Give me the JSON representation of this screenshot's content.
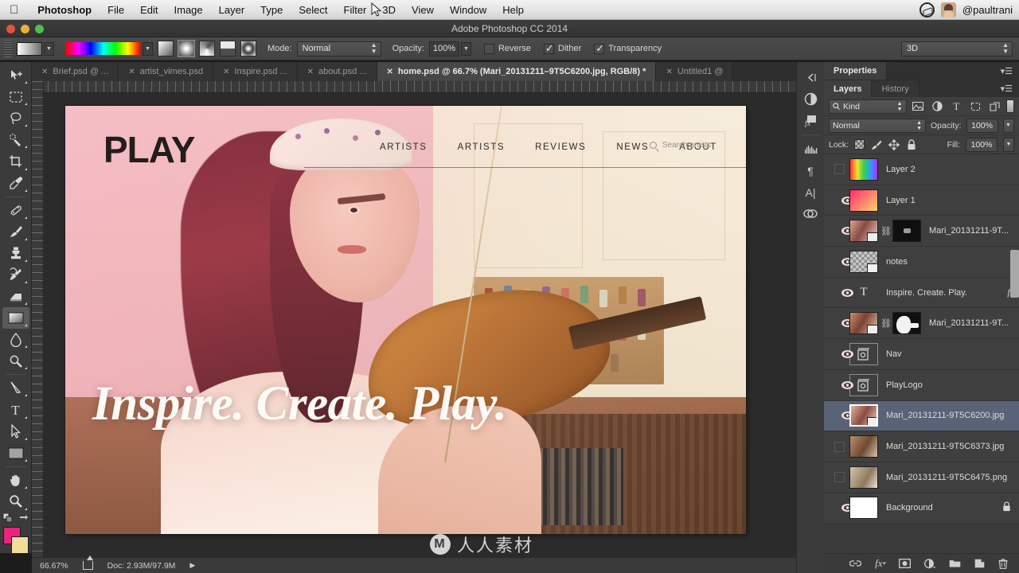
{
  "macmenu": {
    "apple_icon": "apple-logo",
    "items": [
      {
        "label": "Photoshop",
        "bold": true
      },
      {
        "label": "File",
        "bold": false
      },
      {
        "label": "Edit",
        "bold": false
      },
      {
        "label": "Image",
        "bold": false
      },
      {
        "label": "Layer",
        "bold": false
      },
      {
        "label": "Type",
        "bold": false
      },
      {
        "label": "Select",
        "bold": false
      },
      {
        "label": "Filter",
        "bold": false
      },
      {
        "label": "3D",
        "bold": false
      },
      {
        "label": "View",
        "bold": false
      },
      {
        "label": "Window",
        "bold": false
      },
      {
        "label": "Help",
        "bold": false
      }
    ],
    "user_handle": "@paultrani"
  },
  "window": {
    "title": "Adobe Photoshop CC 2014"
  },
  "options_bar": {
    "gradient_preset_label": "gradient-preset",
    "gradient_types": [
      "linear",
      "radial",
      "angle",
      "reflected",
      "diamond"
    ],
    "gradient_type_selected_index": 1,
    "mode_label": "Mode:",
    "mode_value": "Normal",
    "opacity_label": "Opacity:",
    "opacity_value": "100%",
    "reverse_label": "Reverse",
    "reverse_checked": false,
    "dither_label": "Dither",
    "dither_checked": true,
    "transparency_label": "Transparency",
    "transparency_checked": true,
    "workspace_value": "3D"
  },
  "tabs": [
    {
      "label": "Brief.psd @ ...",
      "active": false
    },
    {
      "label": "artist_vimes.psd",
      "active": false
    },
    {
      "label": "Inspire.psd ...",
      "active": false
    },
    {
      "label": "about.psd ...",
      "active": false
    },
    {
      "label": "home.psd @ 66.7% (Mari_20131211–9T5C6200.jpg, RGB/8) *",
      "active": true
    },
    {
      "label": "Untitled1 @",
      "active": false
    }
  ],
  "tabs_overflow": "»",
  "toolbar": {
    "tools": [
      {
        "name": "move-tool",
        "selected": false
      },
      {
        "name": "rectangular-marquee-tool",
        "selected": false
      },
      {
        "name": "lasso-tool",
        "selected": false
      },
      {
        "name": "quick-selection-tool",
        "selected": false
      },
      {
        "name": "crop-tool",
        "selected": false
      },
      {
        "name": "eyedropper-tool",
        "selected": false
      },
      {
        "name": "spot-healing-brush-tool",
        "selected": false
      },
      {
        "name": "brush-tool",
        "selected": false
      },
      {
        "name": "clone-stamp-tool",
        "selected": false
      },
      {
        "name": "history-brush-tool",
        "selected": false
      },
      {
        "name": "eraser-tool",
        "selected": false
      },
      {
        "name": "gradient-tool",
        "selected": true
      },
      {
        "name": "blur-tool",
        "selected": false
      },
      {
        "name": "dodge-tool",
        "selected": false
      },
      {
        "name": "pen-tool",
        "selected": false
      },
      {
        "name": "horizontal-type-tool",
        "selected": false
      },
      {
        "name": "path-selection-tool",
        "selected": false
      },
      {
        "name": "rectangle-tool",
        "selected": false
      },
      {
        "name": "hand-tool",
        "selected": false
      },
      {
        "name": "zoom-tool",
        "selected": false
      }
    ],
    "foreground_color": "#e8247c",
    "background_color": "#f4dc9a"
  },
  "canvas": {
    "site": {
      "logo_text": "PLAY",
      "nav_links": [
        "ARTISTS",
        "ARTISTS",
        "REVIEWS",
        "NEWS",
        "ABOUT"
      ],
      "search_placeholder": "Search artists",
      "headline": "Inspire. Create. Play."
    }
  },
  "status_bar": {
    "zoom": "66.67%",
    "doc_label": "Doc: 2.93M/97.9M"
  },
  "dock": {
    "icons": [
      "adjustments-icon",
      "styles-icon",
      "histogram-icon",
      "paragraph-icon",
      "character-icon",
      "libraries-icon"
    ]
  },
  "panels": {
    "properties_tab": "Properties",
    "layers_tab": "Layers",
    "history_tab": "History",
    "filter": {
      "kind_label": "Kind",
      "icons": [
        "pixel-filter-icon",
        "adjustment-filter-icon",
        "type-filter-icon",
        "shape-filter-icon",
        "smart-object-filter-icon"
      ]
    },
    "blend_mode": "Normal",
    "opacity_label": "Opacity:",
    "opacity_value": "100%",
    "lock_label": "Lock:",
    "fill_label": "Fill:",
    "fill_value": "100%",
    "layers": [
      {
        "name": "Layer 2",
        "visible": false,
        "type": "gradient-rainbow",
        "selected": false,
        "mask": false,
        "fx": false,
        "locked": false
      },
      {
        "name": "Layer 1",
        "visible": true,
        "type": "gradient-pink",
        "selected": false,
        "mask": false,
        "fx": false,
        "locked": false
      },
      {
        "name": "Mari_20131211-9T...",
        "visible": true,
        "type": "smart-photo",
        "selected": false,
        "mask": true,
        "mask_style": "dark",
        "fx": false,
        "locked": false
      },
      {
        "name": "notes",
        "visible": true,
        "type": "transparent",
        "selected": false,
        "mask": false,
        "fx": false,
        "locked": false
      },
      {
        "name": "Inspire. Create. Play.",
        "visible": true,
        "type": "text",
        "selected": false,
        "mask": false,
        "fx": true,
        "locked": false
      },
      {
        "name": "Mari_20131211-9T...",
        "visible": true,
        "type": "smart-photo",
        "selected": false,
        "mask": true,
        "mask_style": "light",
        "fx": false,
        "locked": false
      },
      {
        "name": "Nav",
        "visible": true,
        "type": "smart-object",
        "selected": false,
        "mask": false,
        "fx": false,
        "locked": false
      },
      {
        "name": "PlayLogo",
        "visible": true,
        "type": "smart-object",
        "selected": false,
        "mask": false,
        "fx": false,
        "locked": false
      },
      {
        "name": "Mari_20131211-9T5C6200.jpg",
        "visible": true,
        "type": "smart-photo",
        "selected": true,
        "mask": false,
        "fx": false,
        "locked": false
      },
      {
        "name": "Mari_20131211-9T5C6373.jpg",
        "visible": false,
        "type": "photo",
        "selected": false,
        "mask": false,
        "fx": false,
        "locked": false
      },
      {
        "name": "Mari_20131211-9T5C6475.png",
        "visible": false,
        "type": "photo",
        "selected": false,
        "mask": false,
        "fx": false,
        "locked": false
      },
      {
        "name": "Background",
        "visible": true,
        "type": "white",
        "selected": false,
        "mask": false,
        "fx": false,
        "locked": true
      }
    ],
    "footer_icons": [
      "link-layers-icon",
      "add-layer-style-icon",
      "add-layer-mask-icon",
      "new-adjustment-layer-icon",
      "new-group-icon",
      "new-layer-icon",
      "delete-layer-icon"
    ]
  },
  "watermark": {
    "brand": "人人素材",
    "mark": "M"
  }
}
